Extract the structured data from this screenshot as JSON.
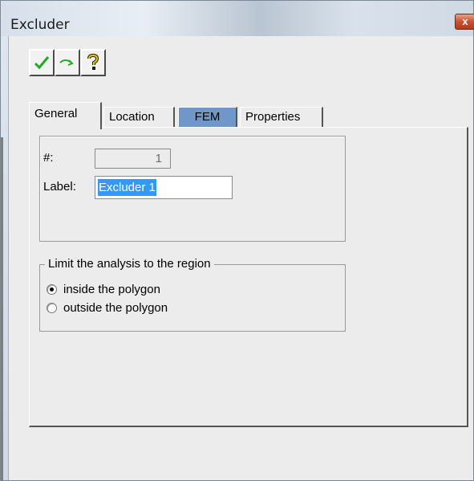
{
  "window": {
    "title": "Excluder",
    "close_label": "x"
  },
  "toolbar": {
    "buttons": [
      {
        "icon": "checkmark-icon",
        "color": "#22aa22"
      },
      {
        "icon": "redo-arrow-icon",
        "color": "#22aa22"
      },
      {
        "icon": "help-question-icon",
        "color": "#c8a000"
      }
    ]
  },
  "tabs": [
    {
      "label": "General",
      "active": true
    },
    {
      "label": "Location",
      "active": false
    },
    {
      "label": "FEM",
      "active": false,
      "highlight": "#6f97c8"
    },
    {
      "label": "Properties",
      "active": false
    }
  ],
  "general": {
    "number_label": "#:",
    "number_value": "1",
    "label_label": "Label:",
    "label_value": "Excluder 1"
  },
  "region": {
    "legend": "Limit the analysis to the region",
    "options": [
      {
        "label": "inside the polygon",
        "checked": true
      },
      {
        "label": "outside the polygon",
        "checked": false
      }
    ]
  }
}
